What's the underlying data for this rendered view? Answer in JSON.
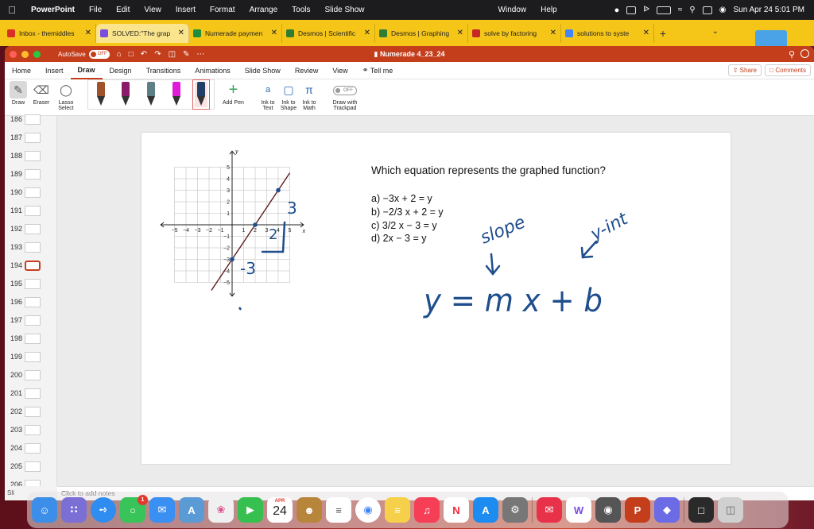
{
  "menubar": {
    "app": "PowerPoint",
    "items": [
      "File",
      "Edit",
      "View",
      "Insert",
      "Format",
      "Arrange",
      "Tools",
      "Slide Show"
    ],
    "window": "Window",
    "help": "Help",
    "clock": "Sun Apr 24  5:01 PM"
  },
  "browser_tabs": [
    {
      "title": "Inbox - themiddles",
      "favicon_color": "#d93025"
    },
    {
      "title": "SOLVED:\"The grap",
      "favicon_color": "#7b4ce0"
    },
    {
      "title": "Numerade paymen",
      "favicon_color": "#1e8e3e"
    },
    {
      "title": "Desmos | Scientific",
      "favicon_color": "#2e7d32"
    },
    {
      "title": "Desmos | Graphing",
      "favicon_color": "#2e7d32"
    },
    {
      "title": "solve by factoring",
      "favicon_color": "#c62828"
    },
    {
      "title": "solutions to syste",
      "favicon_color": "#4285f4"
    }
  ],
  "window": {
    "autosave": "AutoSave",
    "autosave_state": "OFF",
    "title": "Numerade 4_23_24"
  },
  "ribbon_tabs": [
    "Home",
    "Insert",
    "Draw",
    "Design",
    "Transitions",
    "Animations",
    "Slide Show",
    "Review",
    "View"
  ],
  "active_ribbon_tab": "Draw",
  "tell_me": "Tell me",
  "share": "Share",
  "comments": "Comments",
  "tools": {
    "draw": "Draw",
    "eraser": "Eraser",
    "lasso": "Lasso Select",
    "add_pen": "Add Pen",
    "ink_text": "Ink to Text",
    "ink_shape": "Ink to Shape",
    "ink_math": "Ink to Math",
    "trackpad_state": "OFF",
    "trackpad": "Draw with Trackpad"
  },
  "pens": [
    {
      "color": "#a0522d"
    },
    {
      "color": "#8b1a6b"
    },
    {
      "color": "#5f7f86"
    },
    {
      "color": "#e11ad8"
    },
    {
      "color": "#1f3f66"
    }
  ],
  "slides": [
    {
      "n": "186"
    },
    {
      "n": "187"
    },
    {
      "n": "188"
    },
    {
      "n": "189"
    },
    {
      "n": "190"
    },
    {
      "n": "191"
    },
    {
      "n": "192"
    },
    {
      "n": "193"
    },
    {
      "n": "194"
    },
    {
      "n": "195"
    },
    {
      "n": "196"
    },
    {
      "n": "197"
    },
    {
      "n": "198"
    },
    {
      "n": "199"
    },
    {
      "n": "200"
    },
    {
      "n": "201"
    },
    {
      "n": "202"
    },
    {
      "n": "203"
    },
    {
      "n": "204"
    },
    {
      "n": "205"
    },
    {
      "n": "206"
    }
  ],
  "selected_slide": "194",
  "slide": {
    "question": "Which equation represents the graphed function?",
    "choices": [
      "a) −3x + 2 = y",
      "b) −2/3 x + 2 = y",
      "c) 3/2 x − 3 = y",
      "d) 2x − 3 = y"
    ],
    "graph": {
      "xlabel": "x",
      "ylabel": "y",
      "x_ticks": [
        "−5",
        "−4",
        "−3",
        "−2",
        "−1",
        "1",
        "2",
        "3",
        "4",
        "5"
      ],
      "y_ticks": [
        "5",
        "4",
        "3",
        "2",
        "1",
        "−1",
        "−2",
        "−3",
        "−4",
        "−5"
      ],
      "x_range": [
        -5,
        5
      ],
      "y_range": [
        -5,
        5
      ]
    },
    "line": {
      "slope": 1.5,
      "intercept": -3,
      "points": [
        [
          0,
          -3
        ],
        [
          2,
          0
        ],
        [
          4,
          3
        ]
      ]
    },
    "ink": {
      "rise": "3",
      "run": "2",
      "y_intercept_value": "-3",
      "formula": "y = m x + b",
      "slope_label": "slope",
      "yint_label": "y-int",
      "color": "#1f4e8c"
    }
  },
  "notes_placeholder": "Click to add notes",
  "notes_strip": "Sli",
  "dock": {
    "messages_badge": "1",
    "calendar_month": "APR",
    "calendar_day": "24"
  }
}
